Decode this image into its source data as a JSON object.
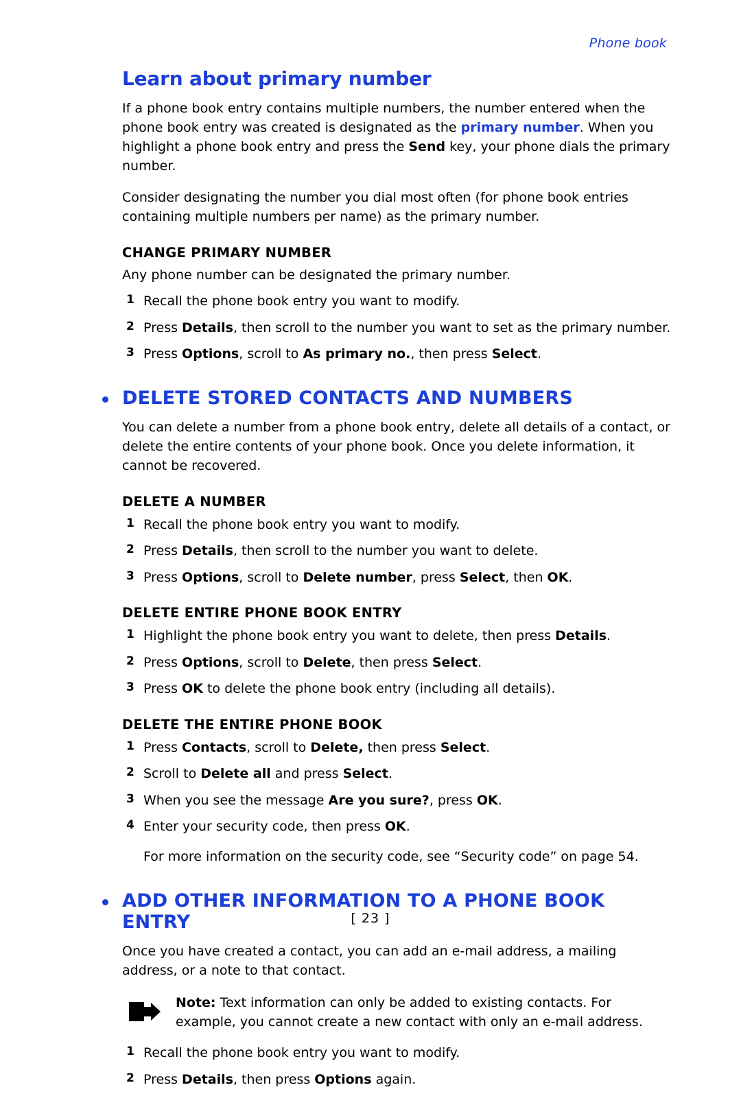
{
  "header": {
    "running_head": "Phone book"
  },
  "footer": {
    "page_number": "[ 23 ]"
  },
  "sections": {
    "primary_number": {
      "title": "Learn about primary number",
      "para1_a": "If a phone book entry contains multiple numbers, the number entered when the phone book entry was created is designated as the ",
      "para1_highlight": "primary number",
      "para1_b": ". When you highlight a phone book entry and press the ",
      "para1_bold": "Send",
      "para1_c": " key, your phone dials the primary number.",
      "para2": "Consider designating the number you dial most often (for phone book entries containing multiple numbers per name) as the primary number.",
      "sub_head": "CHANGE PRIMARY NUMBER",
      "sub_intro": "Any phone number can be designated the primary number.",
      "steps": [
        {
          "num": "1",
          "a": "Recall the phone book entry you want to modify.",
          "b": "",
          "c": "",
          "d": "",
          "e": ""
        },
        {
          "num": "2",
          "a": "Press ",
          "b": "Details",
          "c": ", then scroll to the number you want to set as the primary number.",
          "d": "",
          "e": ""
        },
        {
          "num": "3",
          "a": "Press ",
          "b": "Options",
          "c": ", scroll to ",
          "d": "As primary no.",
          "e": ", then press ",
          "f": "Select",
          "g": "."
        }
      ]
    },
    "delete_stored": {
      "title": "DELETE STORED CONTACTS AND NUMBERS",
      "intro": "You can delete a number from a phone book entry, delete all details of a contact, or delete the entire contents of your phone book. Once you delete information, it cannot be recovered.",
      "sub1": {
        "head": "DELETE A NUMBER",
        "steps": [
          {
            "num": "1",
            "a": "Recall the phone book entry you want to modify."
          },
          {
            "num": "2",
            "a": "Press ",
            "b": "Details",
            "c": ", then scroll to the number you want to delete."
          },
          {
            "num": "3",
            "a": "Press ",
            "b": "Options",
            "c": ", scroll to ",
            "d": "Delete number",
            "e": ", press ",
            "f": "Select",
            "g": ", then ",
            "h": "OK",
            "i": "."
          }
        ]
      },
      "sub2": {
        "head": "DELETE ENTIRE PHONE BOOK ENTRY",
        "steps": [
          {
            "num": "1",
            "a": "Highlight the phone book entry you want to delete, then press ",
            "b": "Details",
            "c": "."
          },
          {
            "num": "2",
            "a": "Press ",
            "b": "Options",
            "c": ", scroll to ",
            "d": "Delete",
            "e": ", then press ",
            "f": "Select",
            "g": "."
          },
          {
            "num": "3",
            "a": "Press ",
            "b": "OK",
            "c": " to delete the phone book entry (including all details)."
          }
        ]
      },
      "sub3": {
        "head": "DELETE THE ENTIRE PHONE BOOK",
        "steps": [
          {
            "num": "1",
            "a": "Press ",
            "b": "Contacts",
            "c": ", scroll to ",
            "d": "Delete,",
            "e": " then press ",
            "f": "Select",
            "g": "."
          },
          {
            "num": "2",
            "a": "Scroll to ",
            "b": "Delete all",
            "c": " and press ",
            "d": "Select",
            "e": "."
          },
          {
            "num": "3",
            "a": "When you see the message ",
            "b": "Are you sure?",
            "c": ", press ",
            "d": "OK",
            "e": "."
          },
          {
            "num": "4",
            "a": "Enter your security code, then press ",
            "b": "OK",
            "c": "."
          }
        ],
        "trailing": "For more information on the security code, see “Security code” on page 54."
      }
    },
    "add_other_info": {
      "title": "ADD OTHER INFORMATION TO A PHONE BOOK ENTRY",
      "intro": "Once you have created a contact, you can add an e-mail address, a mailing address, or a note to that contact.",
      "note_label": "Note:",
      "note_text": " Text information can only be added to existing contacts. For example, you cannot create a new contact with only an e-mail address.",
      "steps": [
        {
          "num": "1",
          "a": "Recall the phone book entry you want to modify."
        },
        {
          "num": "2",
          "a": "Press ",
          "b": "Details",
          "c": ", then press ",
          "d": "Options",
          "e": " again."
        }
      ]
    }
  }
}
